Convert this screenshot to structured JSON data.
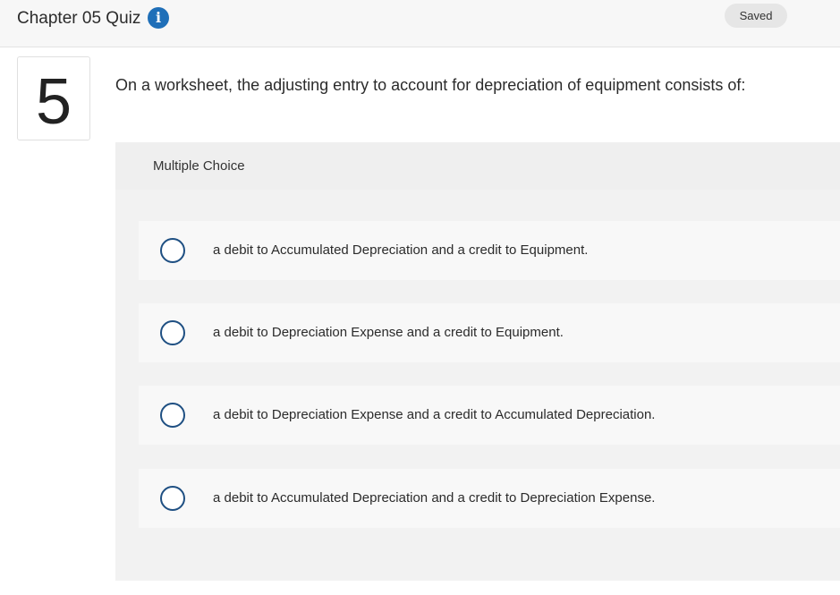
{
  "header": {
    "title": "Chapter 05 Quiz",
    "info_icon_glyph": "i",
    "status": "Saved"
  },
  "question": {
    "number": "5",
    "text": "On a worksheet, the adjusting entry to account for depreciation of equipment consists of:",
    "type_label": "Multiple Choice",
    "options": [
      "a debit to Accumulated Depreciation and a credit to Equipment.",
      "a debit to Depreciation Expense and a credit to Equipment.",
      "a debit to Depreciation Expense and a credit to Accumulated Depreciation.",
      "a debit to Accumulated Depreciation and a credit to Depreciation Expense."
    ]
  },
  "colors": {
    "info_icon": "#1f6fb8",
    "radio_border": "#1e4f82"
  }
}
